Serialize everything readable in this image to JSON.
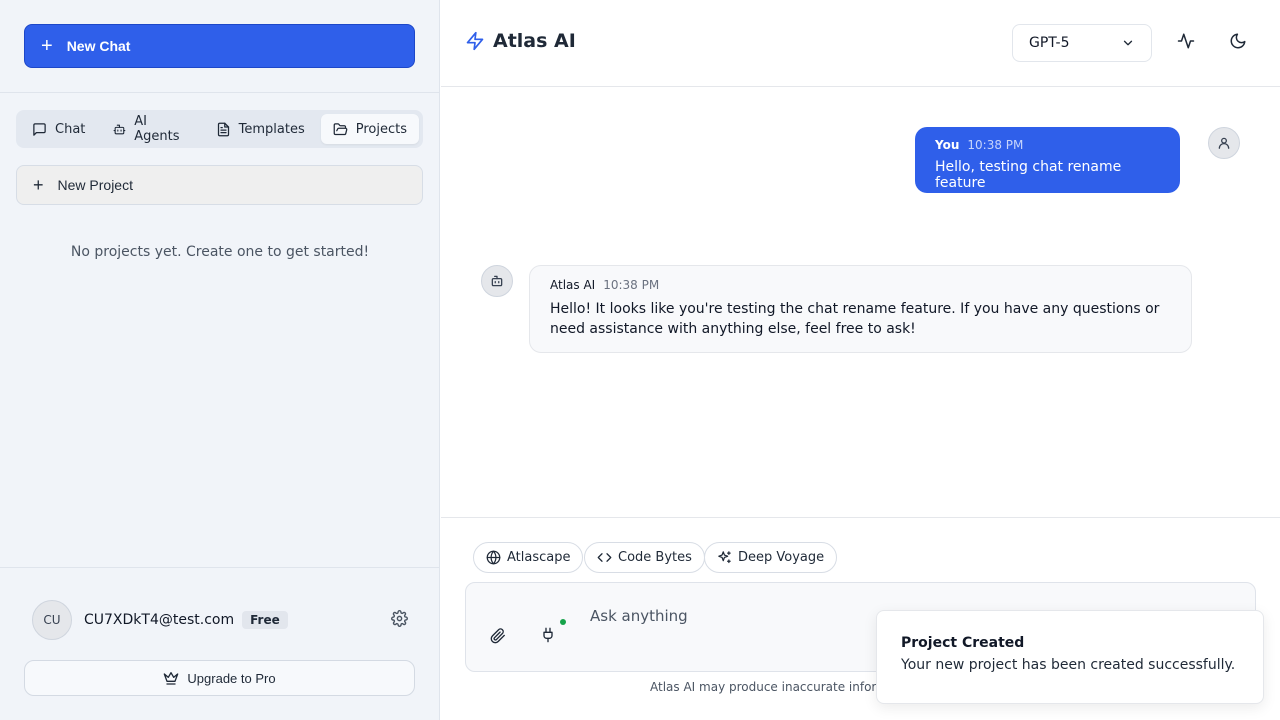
{
  "sidebar": {
    "new_chat_label": "New Chat",
    "tabs": [
      {
        "label": "Chat",
        "icon": "message-square-icon"
      },
      {
        "label": "AI Agents",
        "icon": "bot-icon"
      },
      {
        "label": "Templates",
        "icon": "file-text-icon"
      },
      {
        "label": "Projects",
        "icon": "folder-open-icon",
        "active": true
      }
    ],
    "new_project_label": "New Project",
    "empty_message": "No projects yet. Create one to get started!",
    "user": {
      "initials": "CU",
      "email": "CU7XDkT4@test.com",
      "plan": "Free"
    },
    "upgrade_label": "Upgrade to Pro"
  },
  "header": {
    "app_name": "Atlas AI",
    "model": "GPT-5"
  },
  "messages": [
    {
      "sender": "You",
      "time": "10:38 PM",
      "text": "Hello, testing chat rename feature"
    },
    {
      "sender": "Atlas AI",
      "time": "10:38 PM",
      "text": "Hello! It looks like you're testing the chat rename feature. If you have any questions or need assistance with anything else, feel free to ask!"
    }
  ],
  "composer": {
    "tools": [
      {
        "label": "Atlascape",
        "icon": "globe-icon"
      },
      {
        "label": "Code Bytes",
        "icon": "code-icon"
      },
      {
        "label": "Deep Voyage",
        "icon": "sparkles-icon"
      }
    ],
    "placeholder": "Ask anything",
    "disclaimer": "Atlas AI may produce inaccurate informa"
  },
  "toast": {
    "title": "Project Created",
    "description": "Your new project has been created successfully."
  },
  "colors": {
    "accent": "#2f5fea",
    "sidebar_bg": "#f1f4f9",
    "status_dot": "#16a34a"
  }
}
